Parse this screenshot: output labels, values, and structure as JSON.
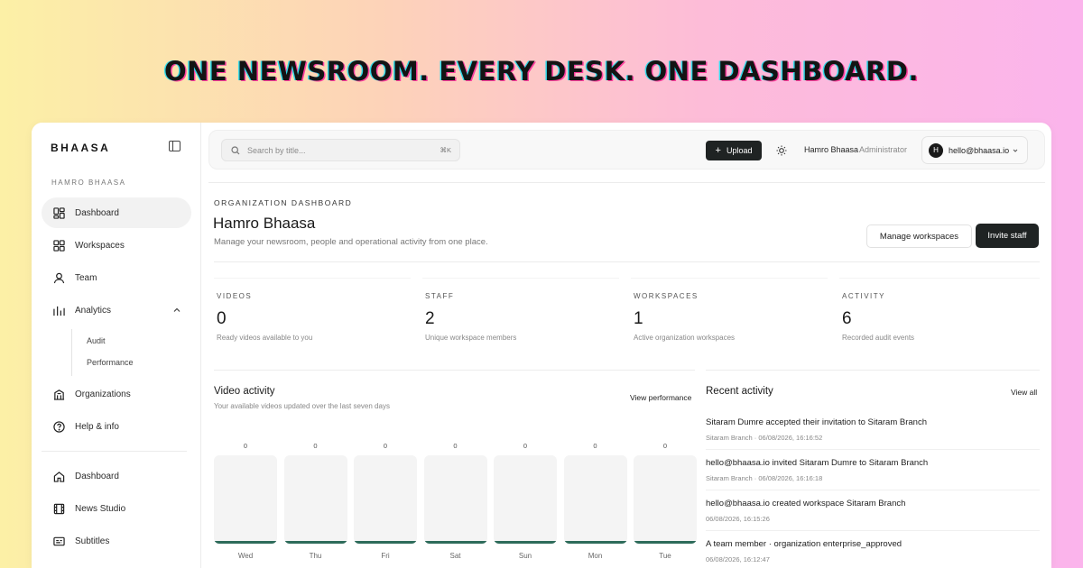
{
  "headline": "ONE NEWSROOM. EVERY DESK. ONE DASHBOARD.",
  "sidebar": {
    "brand": "BHAASA",
    "org_label": "HAMRO BHAASA",
    "items": [
      {
        "label": "Dashboard",
        "icon": "dashboard-icon"
      },
      {
        "label": "Workspaces",
        "icon": "grid-icon"
      },
      {
        "label": "Team",
        "icon": "user-icon"
      },
      {
        "label": "Analytics",
        "icon": "bar-chart-icon"
      },
      {
        "label": "Organizations",
        "icon": "building-icon"
      },
      {
        "label": "Help & info",
        "icon": "help-icon"
      }
    ],
    "analytics_sub": [
      "Audit",
      "Performance"
    ],
    "bottom_items": [
      {
        "label": "Dashboard",
        "icon": "home-icon"
      },
      {
        "label": "News Studio",
        "icon": "film-icon"
      },
      {
        "label": "Subtitles",
        "icon": "captions-icon"
      }
    ]
  },
  "topbar": {
    "search_placeholder": "Search by title...",
    "search_shortcut": "⌘K",
    "upload_label": "Upload",
    "user_name": "Hamro Bhaasa",
    "user_role": "· Administrator",
    "account_initial": "H",
    "account_email": "hello@bhaasa.io"
  },
  "header": {
    "label": "ORGANIZATION DASHBOARD",
    "title": "Hamro Bhaasa",
    "subtitle": "Manage your newsroom, people and operational activity from one place.",
    "manage_workspaces": "Manage workspaces",
    "invite_staff": "Invite staff"
  },
  "stats": [
    {
      "label": "VIDEOS",
      "value": "0",
      "desc": "Ready videos available to you"
    },
    {
      "label": "STAFF",
      "value": "2",
      "desc": "Unique workspace members"
    },
    {
      "label": "WORKSPACES",
      "value": "1",
      "desc": "Active organization workspaces"
    },
    {
      "label": "ACTIVITY",
      "value": "6",
      "desc": "Recorded audit events"
    }
  ],
  "video_activity": {
    "title": "Video activity",
    "subtitle": "Your available videos updated over the last seven days",
    "link": "View performance"
  },
  "chart_data": {
    "type": "bar",
    "categories": [
      "Wed",
      "Thu",
      "Fri",
      "Sat",
      "Sun",
      "Mon",
      "Tue"
    ],
    "values": [
      0,
      0,
      0,
      0,
      0,
      0,
      0
    ],
    "data_labels": [
      "0",
      "0",
      "0",
      "0",
      "0",
      "0",
      "0"
    ],
    "bar_color": "#2d6b5a"
  },
  "recent_activity": {
    "title": "Recent activity",
    "link": "View all",
    "items": [
      {
        "text": "Sitaram Dumre accepted their invitation to Sitaram Branch",
        "meta": "Sitaram Branch · 06/08/2026, 16:16:52"
      },
      {
        "text": "hello@bhaasa.io invited Sitaram Dumre to Sitaram Branch",
        "meta": "Sitaram Branch · 06/08/2026, 16:16:18"
      },
      {
        "text": "hello@bhaasa.io created workspace Sitaram Branch",
        "meta": "06/08/2026, 16:15:26"
      },
      {
        "text": "A team member · organization enterprise_approved",
        "meta": "06/08/2026, 16:12:47"
      }
    ]
  },
  "colors": {
    "accent_dark": "#1f2323",
    "bar_fill": "#2d6b5a",
    "headline_cyan": "#2fd9e8",
    "headline_pink": "#ff3f9e"
  }
}
